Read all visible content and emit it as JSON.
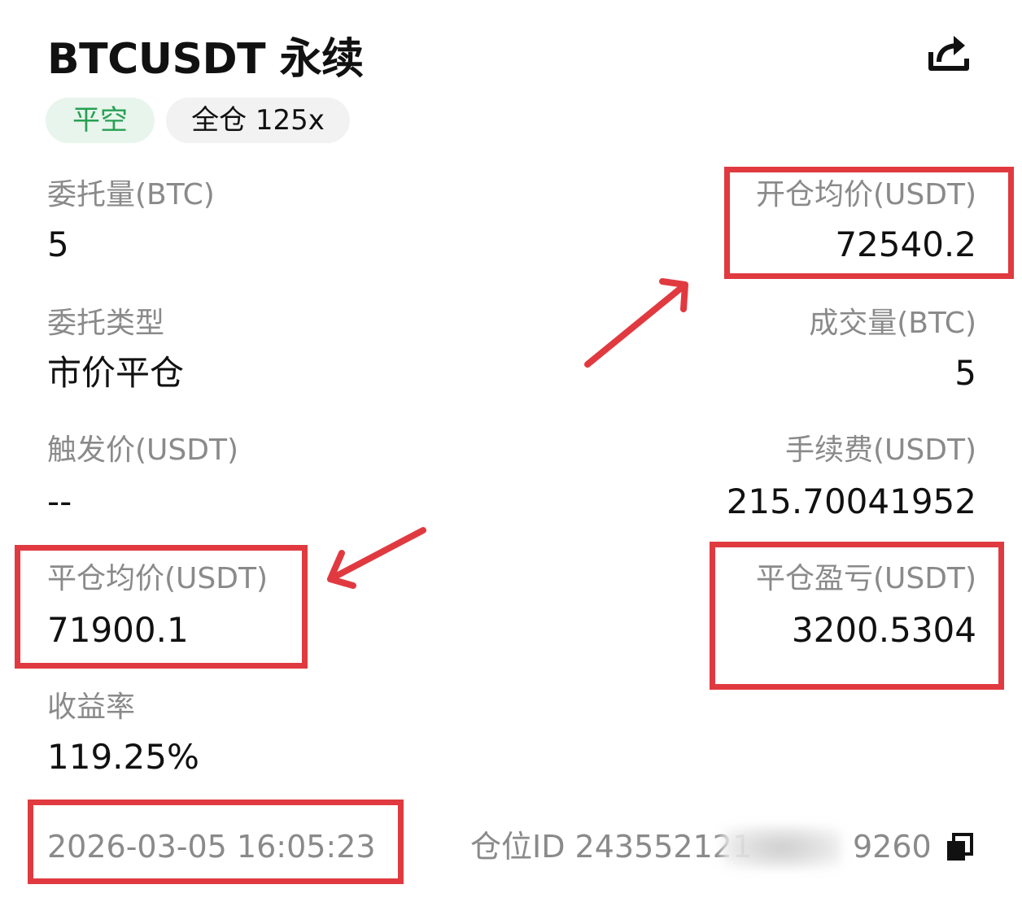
{
  "header": {
    "title": "BTCUSDT 永续",
    "share_icon": "share-icon"
  },
  "tags": {
    "side": "平空",
    "margin": "全仓 125x"
  },
  "fields": {
    "order_qty_label": "委托量(BTC)",
    "order_qty_value": "5",
    "open_avg_label": "开仓均价(USDT)",
    "open_avg_value": "72540.2",
    "order_type_label": "委托类型",
    "order_type_value": "市价平仓",
    "filled_qty_label": "成交量(BTC)",
    "filled_qty_value": "5",
    "trigger_label": "触发价(USDT)",
    "trigger_value": "--",
    "fee_label": "手续费(USDT)",
    "fee_value": "215.70041952",
    "close_avg_label": "平仓均价(USDT)",
    "close_avg_value": "71900.1",
    "close_pnl_label": "平仓盈亏(USDT)",
    "close_pnl_value": "3200.5304",
    "roi_label": "收益率",
    "roi_value": "119.25%"
  },
  "footer": {
    "timestamp": "2026-03-05 16:05:23",
    "position_id_prefix": "仓位ID 243552121",
    "position_id_suffix": "9260",
    "copy_icon": "copy-icon"
  },
  "colors": {
    "green": "#27a052",
    "annotation_red": "#e03a40",
    "label_gray": "#8a8a8a"
  }
}
